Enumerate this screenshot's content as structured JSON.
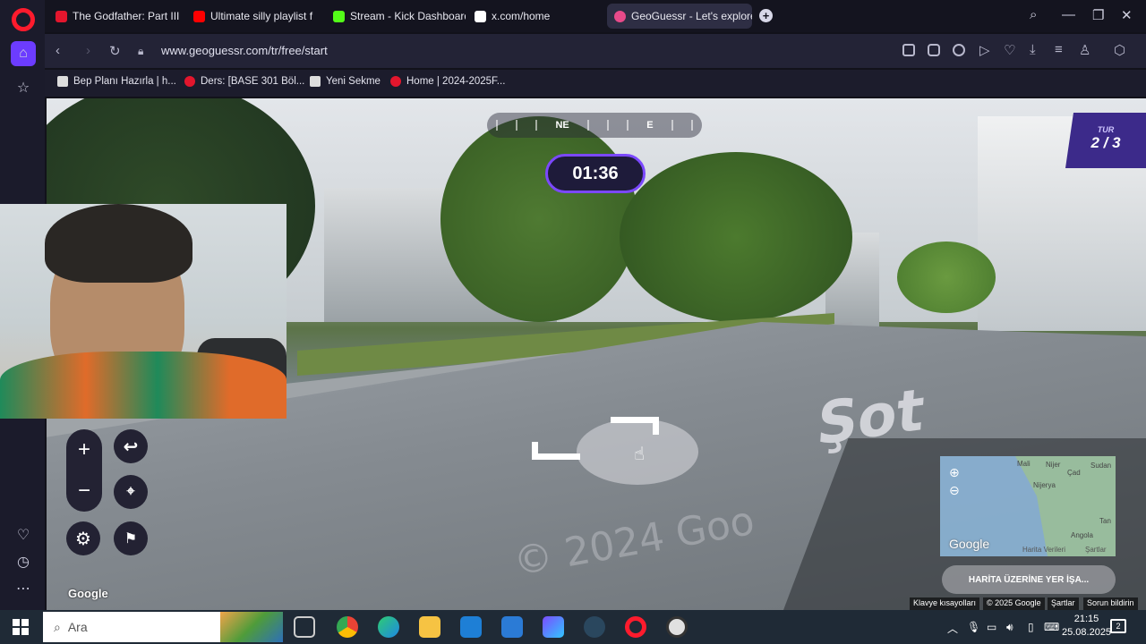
{
  "browser": {
    "tabs": [
      {
        "title": "The Godfather: Part III - B",
        "favicon_color": "#e3162d"
      },
      {
        "title": "Ultimate silly playlist f",
        "favicon_color": "#ff0000"
      },
      {
        "title": "Stream - Kick Dashboard",
        "favicon_color": "#53fc18"
      },
      {
        "title": "x.com/home",
        "favicon_color": "#ffffff"
      },
      {
        "title": "GeoGuessr - Let's explore",
        "favicon_color": "#e84a8a",
        "active": true
      }
    ],
    "url": "www.geoguessr.com/tr/free/start",
    "bookmarks": [
      {
        "label": "Bep Planı Hazırla | h...",
        "icon": "doc"
      },
      {
        "label": "Ders: [BASE 301 Böl...",
        "icon": "red"
      },
      {
        "label": "Yeni Sekme",
        "icon": "doc"
      },
      {
        "label": "Home | 2024-2025F...",
        "icon": "red"
      }
    ]
  },
  "game": {
    "compass": {
      "left": "NE",
      "right": "E"
    },
    "timer": "01:36",
    "round_label": "TUR",
    "round_value": "2 / 3",
    "road_marking": "Şot",
    "watermark": "© 2024 Goo",
    "google_logo": "Google",
    "minimap": {
      "labels": [
        "Mali",
        "Nijer",
        "Çad",
        "Sudan",
        "Nijerya",
        "Angola",
        "Tan"
      ],
      "google": "Google",
      "map_data": "Harita Verileri",
      "terms": "Şartlar"
    },
    "guess_button": "HARİTA ÜZERİNE YER İŞA...",
    "attribution": [
      "Klavye kısayolları",
      "© 2025 Google",
      "Şartlar",
      "Sorun bildirin"
    ]
  },
  "taskbar": {
    "search_placeholder": "Ara",
    "time": "21:15",
    "date": "25.08.2025",
    "notification_count": "2"
  }
}
